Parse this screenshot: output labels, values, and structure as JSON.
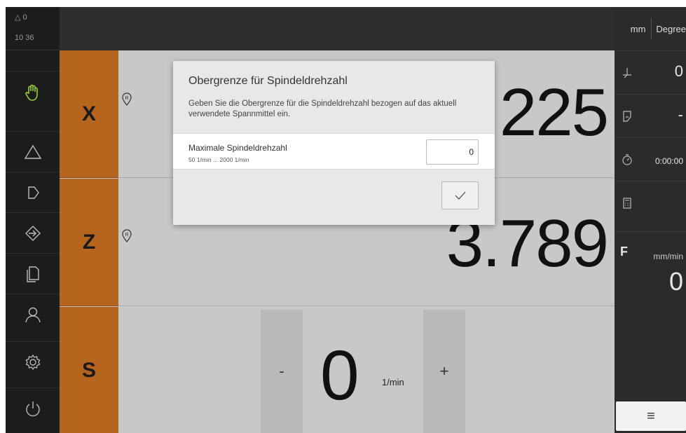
{
  "status": {
    "warning_count": "0",
    "time": "10 36"
  },
  "axes": [
    {
      "label": "X",
      "value": "225"
    },
    {
      "label": "Z",
      "value": "3.789"
    }
  ],
  "spindle": {
    "label": "S",
    "minus": "-",
    "plus": "+",
    "value": "0",
    "unit": "1/min"
  },
  "right_panel": {
    "unit_length": "mm",
    "unit_angle": "Degree",
    "rows": [
      {
        "icon": "zero-point-icon",
        "value": "0"
      },
      {
        "icon": "tool-icon",
        "value": "-"
      },
      {
        "icon": "stopwatch-icon",
        "value": "0:00:00"
      },
      {
        "icon": "calculator-icon",
        "value": ""
      }
    ],
    "feed": {
      "label": "F",
      "unit": "mm/min",
      "value": "0"
    },
    "menu_glyph": "≡"
  },
  "dialog": {
    "title": "Obergrenze für Spindeldrehzahl",
    "description": "Geben Sie die Obergrenze für die Spindeldrehzahl bezogen auf das aktuell verwendete Spannmittel ein.",
    "field_label": "Maximale Spindeldrehzahl",
    "field_range": "50 1/min ... 2000 1/min",
    "field_value": "0"
  },
  "colors": {
    "axis_accent": "#b5651d",
    "sidebar_active": "#9acd32"
  }
}
